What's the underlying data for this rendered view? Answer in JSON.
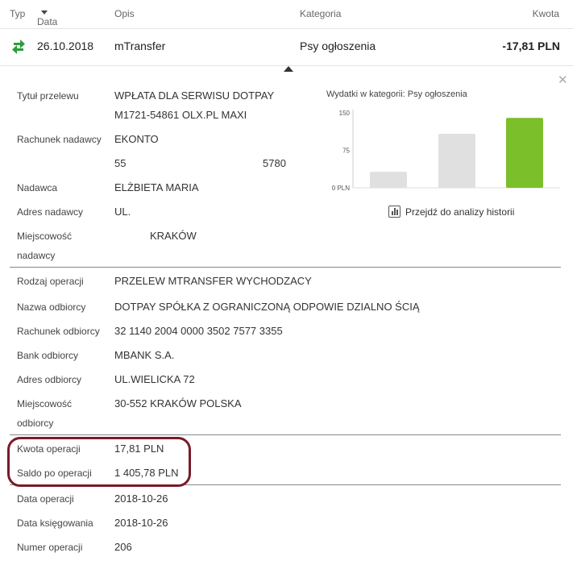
{
  "header": {
    "typ": "Typ",
    "data": "Data",
    "opis": "Opis",
    "kategoria": "Kategoria",
    "kwota": "Kwota"
  },
  "transaction": {
    "date": "26.10.2018",
    "opis": "mTransfer",
    "kategoria": "Psy ogłoszenia",
    "kwota": "-17,81 PLN",
    "icon": "transfer-arrows-icon",
    "icon_color": "#2a9d3a"
  },
  "details": {
    "tytul_label": "Tytuł przelewu",
    "tytul_line1": "WPŁATA DLA SERWISU DOTPAY",
    "tytul_line2": "M1721-54861 OLX.PL MAXI",
    "rachunek_nadawcy_label": "Rachunek nadawcy",
    "rachunek_nadawcy_line1": "EKONTO",
    "rachunek_nadawcy_part1": "55",
    "rachunek_nadawcy_part2": "5780",
    "nadawca_label": "Nadawca",
    "nadawca": "ELŻBIETA MARIA",
    "adres_nadawcy_label": "Adres nadawcy",
    "adres_nadawcy": "UL.",
    "miejscowosc_nadawcy_label1": "Miejscowość",
    "miejscowosc_nadawcy_label2": "nadawcy",
    "miejscowosc_nadawcy": "KRAKÓW",
    "rodzaj_label": "Rodzaj operacji",
    "rodzaj": "PRZELEW MTRANSFER WYCHODZACY",
    "nazwa_odbiorcy_label": "Nazwa odbiorcy",
    "nazwa_odbiorcy": "DOTPAY SPÓŁKA Z OGRANICZONĄ ODPOWIE DZIALNO ŚCIĄ",
    "rachunek_odbiorcy_label": "Rachunek odbiorcy",
    "rachunek_odbiorcy": "32 1140 2004 0000 3502 7577 3355",
    "bank_odbiorcy_label": "Bank odbiorcy",
    "bank_odbiorcy": "MBANK S.A.",
    "adres_odbiorcy_label": "Adres odbiorcy",
    "adres_odbiorcy": "UL.WIELICKA 72",
    "miejscowosc_odbiorcy_label1": "Miejscowość",
    "miejscowosc_odbiorcy_label2": "odbiorcy",
    "miejscowosc_odbiorcy": "30-552 KRAKÓW POLSKA",
    "kwota_operacji_label": "Kwota operacji",
    "kwota_operacji": "17,81 PLN",
    "saldo_label": "Saldo po operacji",
    "saldo": "1 405,78 PLN",
    "data_operacji_label": "Data operacji",
    "data_operacji": "2018-10-26",
    "data_ksiegowania_label": "Data księgowania",
    "data_ksiegowania": "2018-10-26",
    "numer_operacji_label": "Numer operacji",
    "numer_operacji": "206"
  },
  "chart_title": "Wydatki w kategorii:  Psy ogłoszenia",
  "history_link": "Przejdź do analizy historii",
  "highlight_color": "#7a1a2a",
  "chart_data": {
    "type": "bar",
    "title": "Wydatki w kategorii:  Psy ogłoszenia",
    "xlabel": "",
    "ylabel": "",
    "yticks": [
      "0 PLN",
      "75",
      "150"
    ],
    "ylim": [
      0,
      150
    ],
    "grid": false,
    "series": [
      {
        "values": [
          32,
          108,
          140
        ],
        "colors": [
          "#e0e0e0",
          "#e0e0e0",
          "#7bbf2a"
        ]
      }
    ]
  }
}
